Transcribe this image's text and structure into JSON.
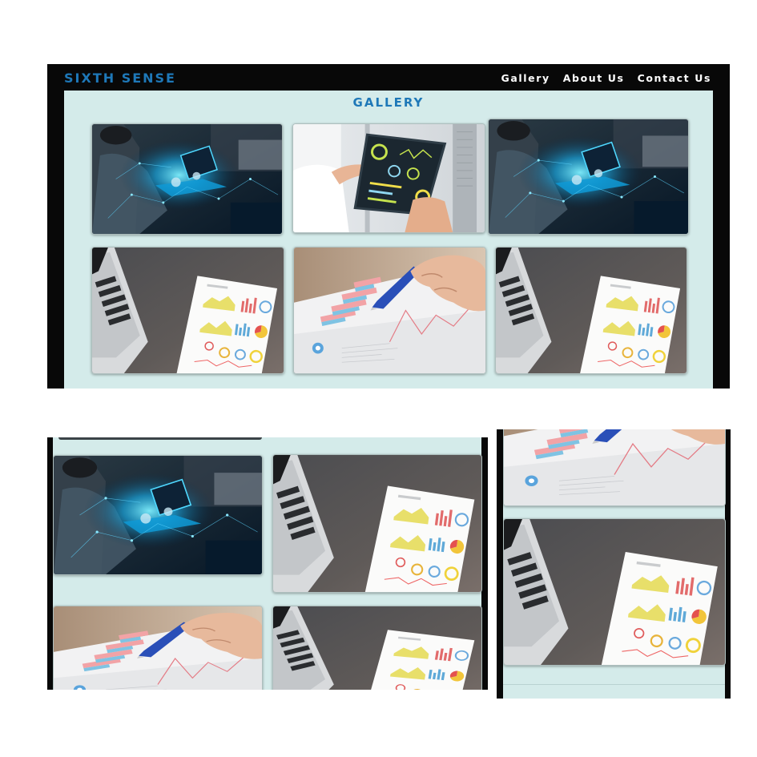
{
  "header": {
    "brand": "SIXTH SENSE",
    "nav": [
      "Gallery",
      "About Us",
      "Contact Us"
    ]
  },
  "gallery": {
    "title": "GALLERY",
    "images": [
      "tablet-glow-photo",
      "tablet-dashboard-photo",
      "tablet-glow-photo",
      "laptop-report-photo",
      "pen-chart-photo",
      "laptop-report-photo"
    ]
  },
  "mobile_views": {
    "view_1_images": [
      "tablet-glow-photo",
      "laptop-report-photo",
      "pen-chart-photo",
      "laptop-report-photo"
    ],
    "view_2_images": [
      "pen-chart-photo",
      "laptop-report-photo"
    ]
  },
  "colors": {
    "brand": "#1e78b8",
    "nav_background": "#080808",
    "gallery_background": "#d4ebea",
    "nav_text": "#ffffff"
  }
}
